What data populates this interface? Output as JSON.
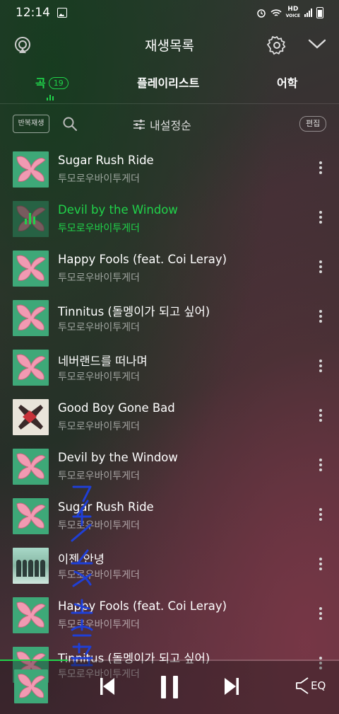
{
  "status": {
    "time": "12:14",
    "hd": "HD",
    "voice": "VOICE"
  },
  "header": {
    "title": "재생목록"
  },
  "tabs": {
    "songs": {
      "label": "곡",
      "count": "19"
    },
    "playlist": {
      "label": "플레이리스트"
    },
    "lang": {
      "label": "어학"
    }
  },
  "toolbar": {
    "repeat": "반복재생",
    "sort": "내설정순",
    "edit": "편집"
  },
  "songs": [
    {
      "title": "Sugar Rush Ride",
      "artist": "투모로우바이투게더",
      "art": "stay"
    },
    {
      "title": "Devil by the Window",
      "artist": "투모로우바이투게더",
      "art": "stay",
      "playing": true
    },
    {
      "title": "Happy Fools (feat. Coi Leray)",
      "artist": "투모로우바이투게더",
      "art": "stay"
    },
    {
      "title": "Tinnitus (돌멩이가 되고 싶어)",
      "artist": "투모로우바이투게더",
      "art": "stay"
    },
    {
      "title": "네버랜드를 떠나며",
      "artist": "투모로우바이투게더",
      "art": "stay"
    },
    {
      "title": "Good Boy Gone Bad",
      "artist": "투모로우바이투게더",
      "art": "cube"
    },
    {
      "title": "Devil by the Window",
      "artist": "투모로우바이투게더",
      "art": "stay"
    },
    {
      "title": "Sugar Rush Ride",
      "artist": "투모로우바이투게더",
      "art": "stay"
    },
    {
      "title": "이젠 안녕",
      "artist": "투모로우바이투게더",
      "art": "photo"
    },
    {
      "title": "Happy Fools (feat. Coi Leray)",
      "artist": "투모로우바이투게더",
      "art": "stay"
    },
    {
      "title": "Tinnitus (돌멩이가 되고 싶어)",
      "artist": "투모로우바이투게더",
      "art": "stay"
    }
  ],
  "player": {
    "progress": 0.2,
    "eq_label": "EQ"
  },
  "watermark": {
    "text": "프로잭/12/17"
  },
  "colors": {
    "accent": "#20d34a",
    "ribbon": "#f19ab2",
    "art_green": "#3ea878"
  }
}
